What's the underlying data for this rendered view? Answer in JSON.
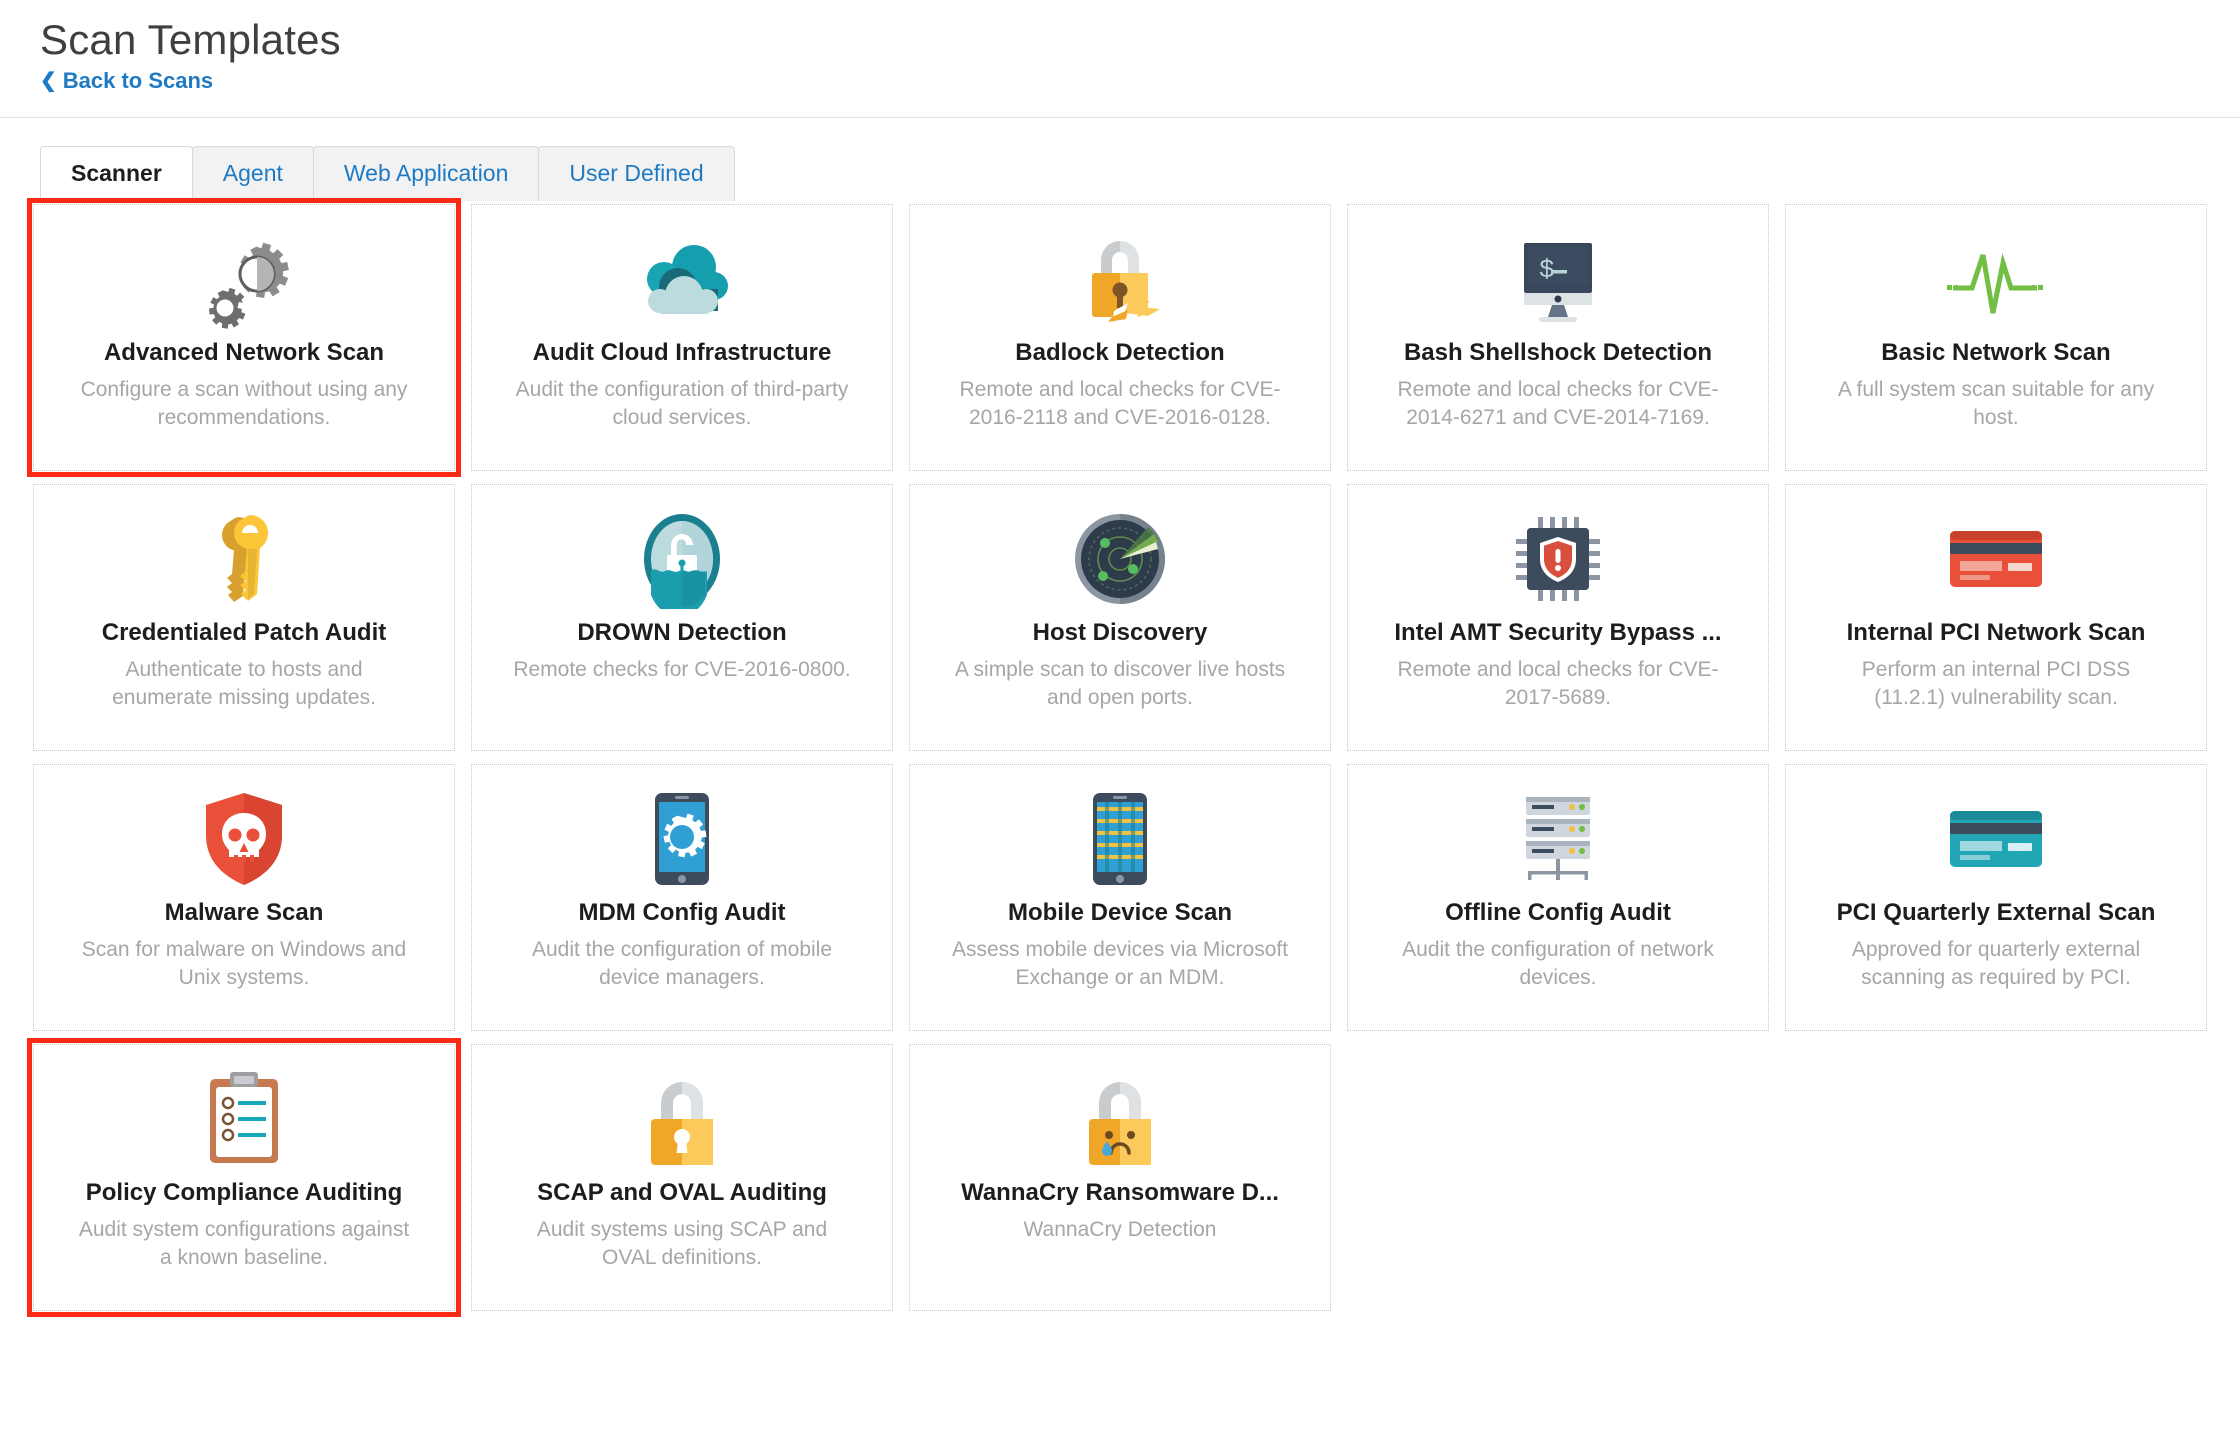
{
  "header": {
    "title": "Scan Templates",
    "back_link": "Back to Scans",
    "back_chevron": "chevron-left-icon"
  },
  "tabs": [
    {
      "label": "Scanner",
      "active": true
    },
    {
      "label": "Agent",
      "active": false
    },
    {
      "label": "Web Application",
      "active": false
    },
    {
      "label": "User Defined",
      "active": false
    }
  ],
  "templates": [
    {
      "title": "Advanced Network Scan",
      "desc": "Configure a scan without using any recommendations.",
      "icon": "gears-icon",
      "highlighted": true
    },
    {
      "title": "Audit Cloud Infrastructure",
      "desc": "Audit the configuration of third-party cloud services.",
      "icon": "cloud-icon",
      "highlighted": false
    },
    {
      "title": "Badlock Detection",
      "desc": "Remote and local checks for CVE-2016-2118 and CVE-2016-0128.",
      "icon": "broken-padlock-icon",
      "highlighted": false
    },
    {
      "title": "Bash Shellshock Detection",
      "desc": "Remote and local checks for CVE-2014-6271 and CVE-2014-7169.",
      "icon": "terminal-monitor-icon",
      "highlighted": false
    },
    {
      "title": "Basic Network Scan",
      "desc": "A full system scan suitable for any host.",
      "icon": "pulse-line-icon",
      "highlighted": false
    },
    {
      "title": "Credentialed Patch Audit",
      "desc": "Authenticate to hosts and enumerate missing updates.",
      "icon": "keys-icon",
      "highlighted": false
    },
    {
      "title": "DROWN Detection",
      "desc": "Remote checks for CVE-2016-0800.",
      "icon": "drowning-padlock-icon",
      "highlighted": false
    },
    {
      "title": "Host Discovery",
      "desc": "A simple scan to discover live hosts and open ports.",
      "icon": "radar-icon",
      "highlighted": false
    },
    {
      "title": "Intel AMT Security Bypass ...",
      "desc": "Remote and local checks for CVE-2017-5689.",
      "icon": "cpu-shield-icon",
      "highlighted": false
    },
    {
      "title": "Internal PCI Network Scan",
      "desc": "Perform an internal PCI DSS (11.2.1) vulnerability scan.",
      "icon": "credit-card-orange-icon",
      "highlighted": false
    },
    {
      "title": "Malware Scan",
      "desc": "Scan for malware on Windows and Unix systems.",
      "icon": "skull-shield-icon",
      "highlighted": false
    },
    {
      "title": "MDM Config Audit",
      "desc": "Audit the configuration of mobile device managers.",
      "icon": "phone-gear-icon",
      "highlighted": false
    },
    {
      "title": "Mobile Device Scan",
      "desc": "Assess mobile devices via Microsoft Exchange or an MDM.",
      "icon": "phone-grid-icon",
      "highlighted": false
    },
    {
      "title": "Offline Config Audit",
      "desc": "Audit the configuration of network devices.",
      "icon": "server-stack-icon",
      "highlighted": false
    },
    {
      "title": "PCI Quarterly External Scan",
      "desc": "Approved for quarterly external scanning as required by PCI.",
      "icon": "credit-card-teal-icon",
      "highlighted": false
    },
    {
      "title": "Policy Compliance Auditing",
      "desc": "Audit system configurations against a known baseline.",
      "icon": "clipboard-checklist-icon",
      "highlighted": true
    },
    {
      "title": "SCAP and OVAL Auditing",
      "desc": "Audit systems using SCAP and OVAL definitions.",
      "icon": "padlock-yellow-icon",
      "highlighted": false
    },
    {
      "title": "WannaCry Ransomware D...",
      "desc": "WannaCry Detection",
      "icon": "padlock-crying-icon",
      "highlighted": false
    }
  ],
  "colors": {
    "link": "#1f7ac4",
    "highlight": "#fb2a14",
    "title_text": "#1d1d1d",
    "desc_text": "#a6a6a6",
    "card_border": "#c8c8c8"
  }
}
